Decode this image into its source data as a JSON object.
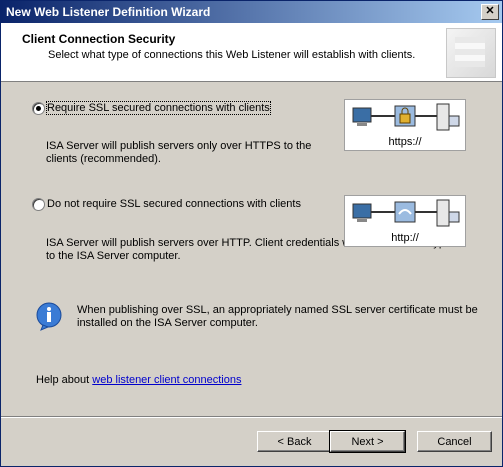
{
  "window": {
    "title": "New Web Listener Definition Wizard",
    "close_symbol": "✕"
  },
  "header": {
    "title": "Client Connection Security",
    "subtitle": "Select what type of connections this Web Listener will establish with clients."
  },
  "options": [
    {
      "label": "Require SSL secured connections with clients",
      "selected": true,
      "description": "ISA Server will publish servers only over HTTPS to the clients (recommended).",
      "diagram_caption": "https://"
    },
    {
      "label": "Do not require SSL secured connections with clients",
      "selected": false,
      "description": "ISA Server will publish servers over HTTP. Client credentials will be sent unencrypted to the ISA Server computer.",
      "diagram_caption": "http://"
    }
  ],
  "info": {
    "icon": "info-icon",
    "text": "When publishing over SSL, an appropriately named SSL server certificate must be installed on the ISA Server computer."
  },
  "help": {
    "prefix": "Help about ",
    "link": "web listener client connections"
  },
  "buttons": {
    "back": "< Back",
    "next": "Next >",
    "cancel": "Cancel"
  },
  "colors": {
    "titlebar_start": "#0a246a",
    "titlebar_end": "#a6caf0",
    "link": "#0000cc"
  }
}
